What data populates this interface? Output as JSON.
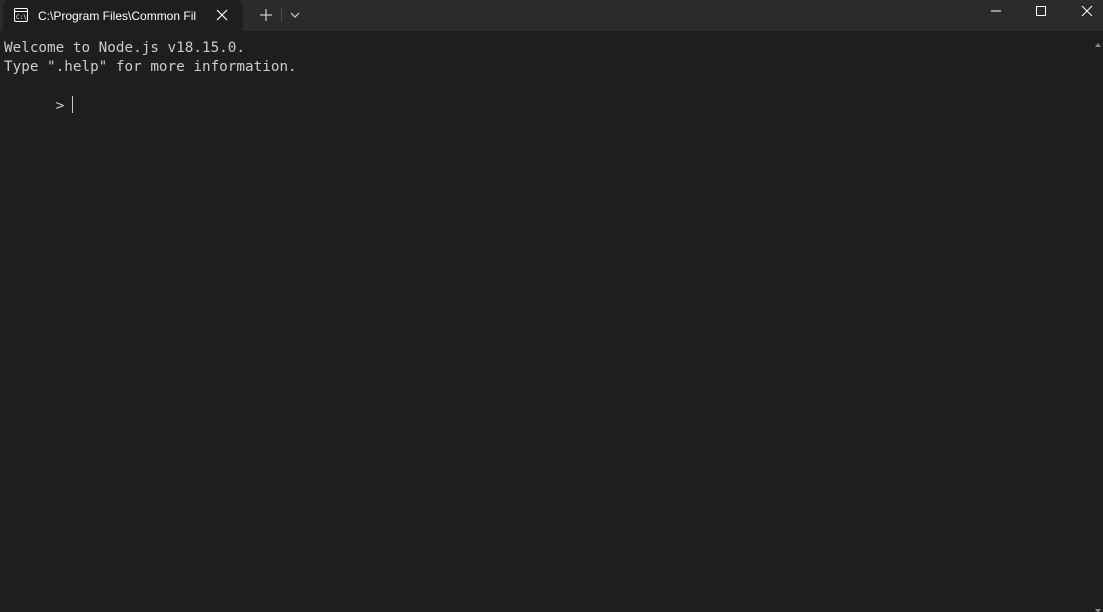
{
  "window": {
    "colors": {
      "titlebar": "#2b2b2b",
      "tab_active": "#1e1e1e",
      "terminal_bg": "#1e1e1e",
      "terminal_fg": "#cccccc",
      "tab_text": "#ffffff"
    }
  },
  "tab": {
    "title": "C:\\Program Files\\Common Fil",
    "icon": "terminal-icon",
    "close_icon": "close-icon"
  },
  "titlebar": {
    "new_tab_icon": "plus-icon",
    "dropdown_icon": "chevron-down-icon",
    "minimize_icon": "minimize-icon",
    "maximize_icon": "maximize-icon",
    "close_icon": "close-icon"
  },
  "terminal": {
    "lines": [
      "Welcome to Node.js v18.15.0.",
      "Type \".help\" for more information.",
      ">"
    ]
  }
}
